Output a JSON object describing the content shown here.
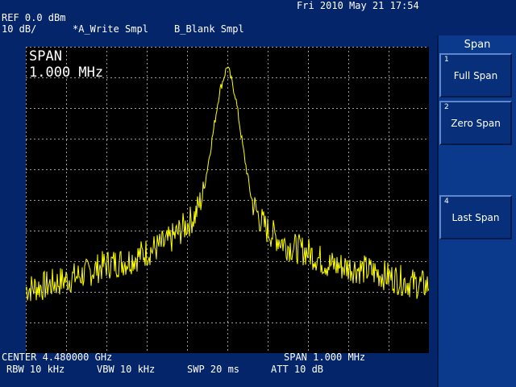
{
  "header": {
    "datetime": "Fri 2010 May 21 17:54",
    "ref_level": "REF 0.0 dBm",
    "scale": "10 dB/",
    "trace_a": "*A_Write Smpl",
    "trace_b": "B_Blank Smpl"
  },
  "display": {
    "param_title": "SPAN",
    "param_value": "1.000 MHz",
    "trace_color": "#ffff00",
    "grid_color": "#9a9a9a",
    "background": "#000000"
  },
  "footer": {
    "center": "CENTER 4.480000 GHz",
    "span": "SPAN 1.000 MHz",
    "rbw": "RBW 10 kHz",
    "vbw": "VBW 10 kHz",
    "swp": "SWP 20 ms",
    "att": "ATT 10 dB"
  },
  "menu": {
    "title": "Span",
    "softkeys": [
      {
        "num": "1",
        "label": "Full Span"
      },
      {
        "num": "2",
        "label": "Zero Span"
      },
      {
        "num": "4",
        "label": "Last Span"
      }
    ]
  },
  "chart_data": {
    "type": "line",
    "x_center_ghz": 4.48,
    "x_span_mhz": 1.0,
    "ylim": [
      -100,
      0
    ],
    "grid": true,
    "series": [
      {
        "x_offset_mhz": [
          -0.5,
          -0.45,
          -0.4,
          -0.35,
          -0.3,
          -0.25,
          -0.2,
          -0.15,
          -0.1,
          -0.08,
          -0.06,
          -0.04,
          -0.02,
          0.0,
          0.02,
          0.04,
          0.06,
          0.08,
          0.1,
          0.15,
          0.2,
          0.25,
          0.3,
          0.35,
          0.4,
          0.45,
          0.5
        ],
        "values_dbm": [
          -79,
          -78,
          -76,
          -74,
          -71,
          -70,
          -67,
          -64,
          -58,
          -55,
          -48,
          -32,
          -15,
          -6,
          -16,
          -34,
          -50,
          -56,
          -60,
          -65,
          -67,
          -71,
          -72,
          -73,
          -75,
          -77,
          -78
        ]
      }
    ]
  }
}
